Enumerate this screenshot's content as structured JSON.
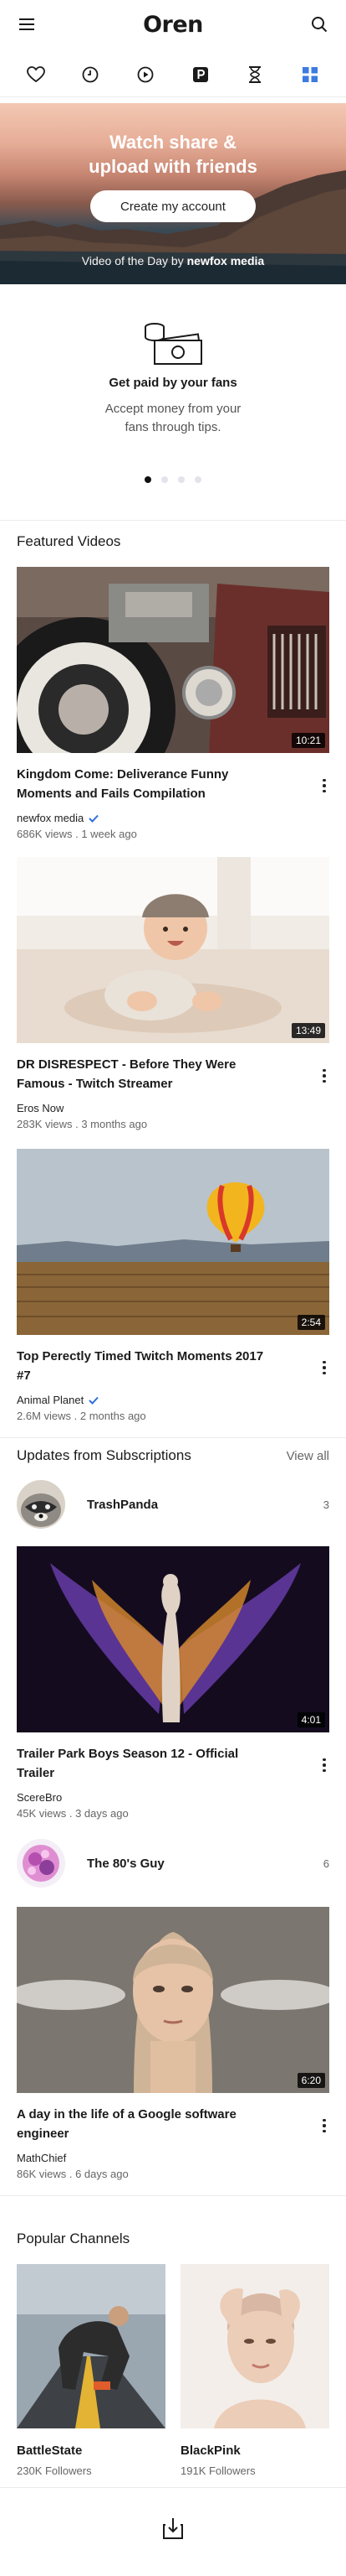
{
  "app": {
    "logo": "Oren"
  },
  "hero": {
    "title_line1": "Watch share &",
    "title_line2": "upload with friends",
    "button_label": "Create my account",
    "caption_prefix": "Video of the Day by",
    "caption_brand": "newfox media"
  },
  "promo": {
    "title": "Get paid by your fans",
    "text_line1": "Accept money from your",
    "text_line2": "fans through tips."
  },
  "carousel": {
    "active_index": 0,
    "dot_count": 4
  },
  "featured": {
    "title": "Featured Videos",
    "videos": [
      {
        "title": "Kingdom Come: Deliverance Funny Moments and Fails Compilation",
        "channel": "newfox media",
        "verified": true,
        "meta": "686K views . 1 week ago",
        "duration": "10:21"
      },
      {
        "title": "DR DISRESPECT - Before They Were Famous - Twitch Streamer",
        "channel": "Eros Now",
        "verified": false,
        "meta": "283K views . 3 months ago",
        "duration": "13:49"
      },
      {
        "title": "Top Perectly Timed Twitch Moments 2017 #7",
        "channel": "Animal Planet",
        "verified": true,
        "meta": "2.6M views . 2 months ago",
        "duration": "2:54"
      }
    ]
  },
  "subscriptions": {
    "title": "Updates from Subscriptions",
    "view_all": "View all",
    "channels": [
      {
        "name": "TrashPanda",
        "count": "3"
      },
      {
        "name": "The 80's Guy",
        "count": "6"
      }
    ],
    "videos": [
      {
        "title": "Trailer Park Boys Season 12 - Official Trailer",
        "channel": "ScereBro",
        "meta": "45K views . 3 days ago",
        "duration": "4:01"
      },
      {
        "title": "A day in the life of a Google software engineer",
        "channel": "MathChief",
        "meta": "86K views . 6 days ago",
        "duration": "6:20"
      }
    ]
  },
  "popular": {
    "title": "Popular Channels",
    "channels": [
      {
        "name": "BattleState",
        "followers": "230K Followers"
      },
      {
        "name": "BlackPink",
        "followers": "191K Followers"
      }
    ]
  },
  "icons": {
    "menu": "menu-icon",
    "search": "search-icon",
    "tabs": [
      "heart-icon",
      "clock-icon",
      "play-icon",
      "parking-icon",
      "hourglass-icon",
      "grid-icon"
    ],
    "bottom": "download-icon"
  },
  "colors": {
    "accent": "#3d7be0",
    "verified": "#2f6fe0"
  }
}
